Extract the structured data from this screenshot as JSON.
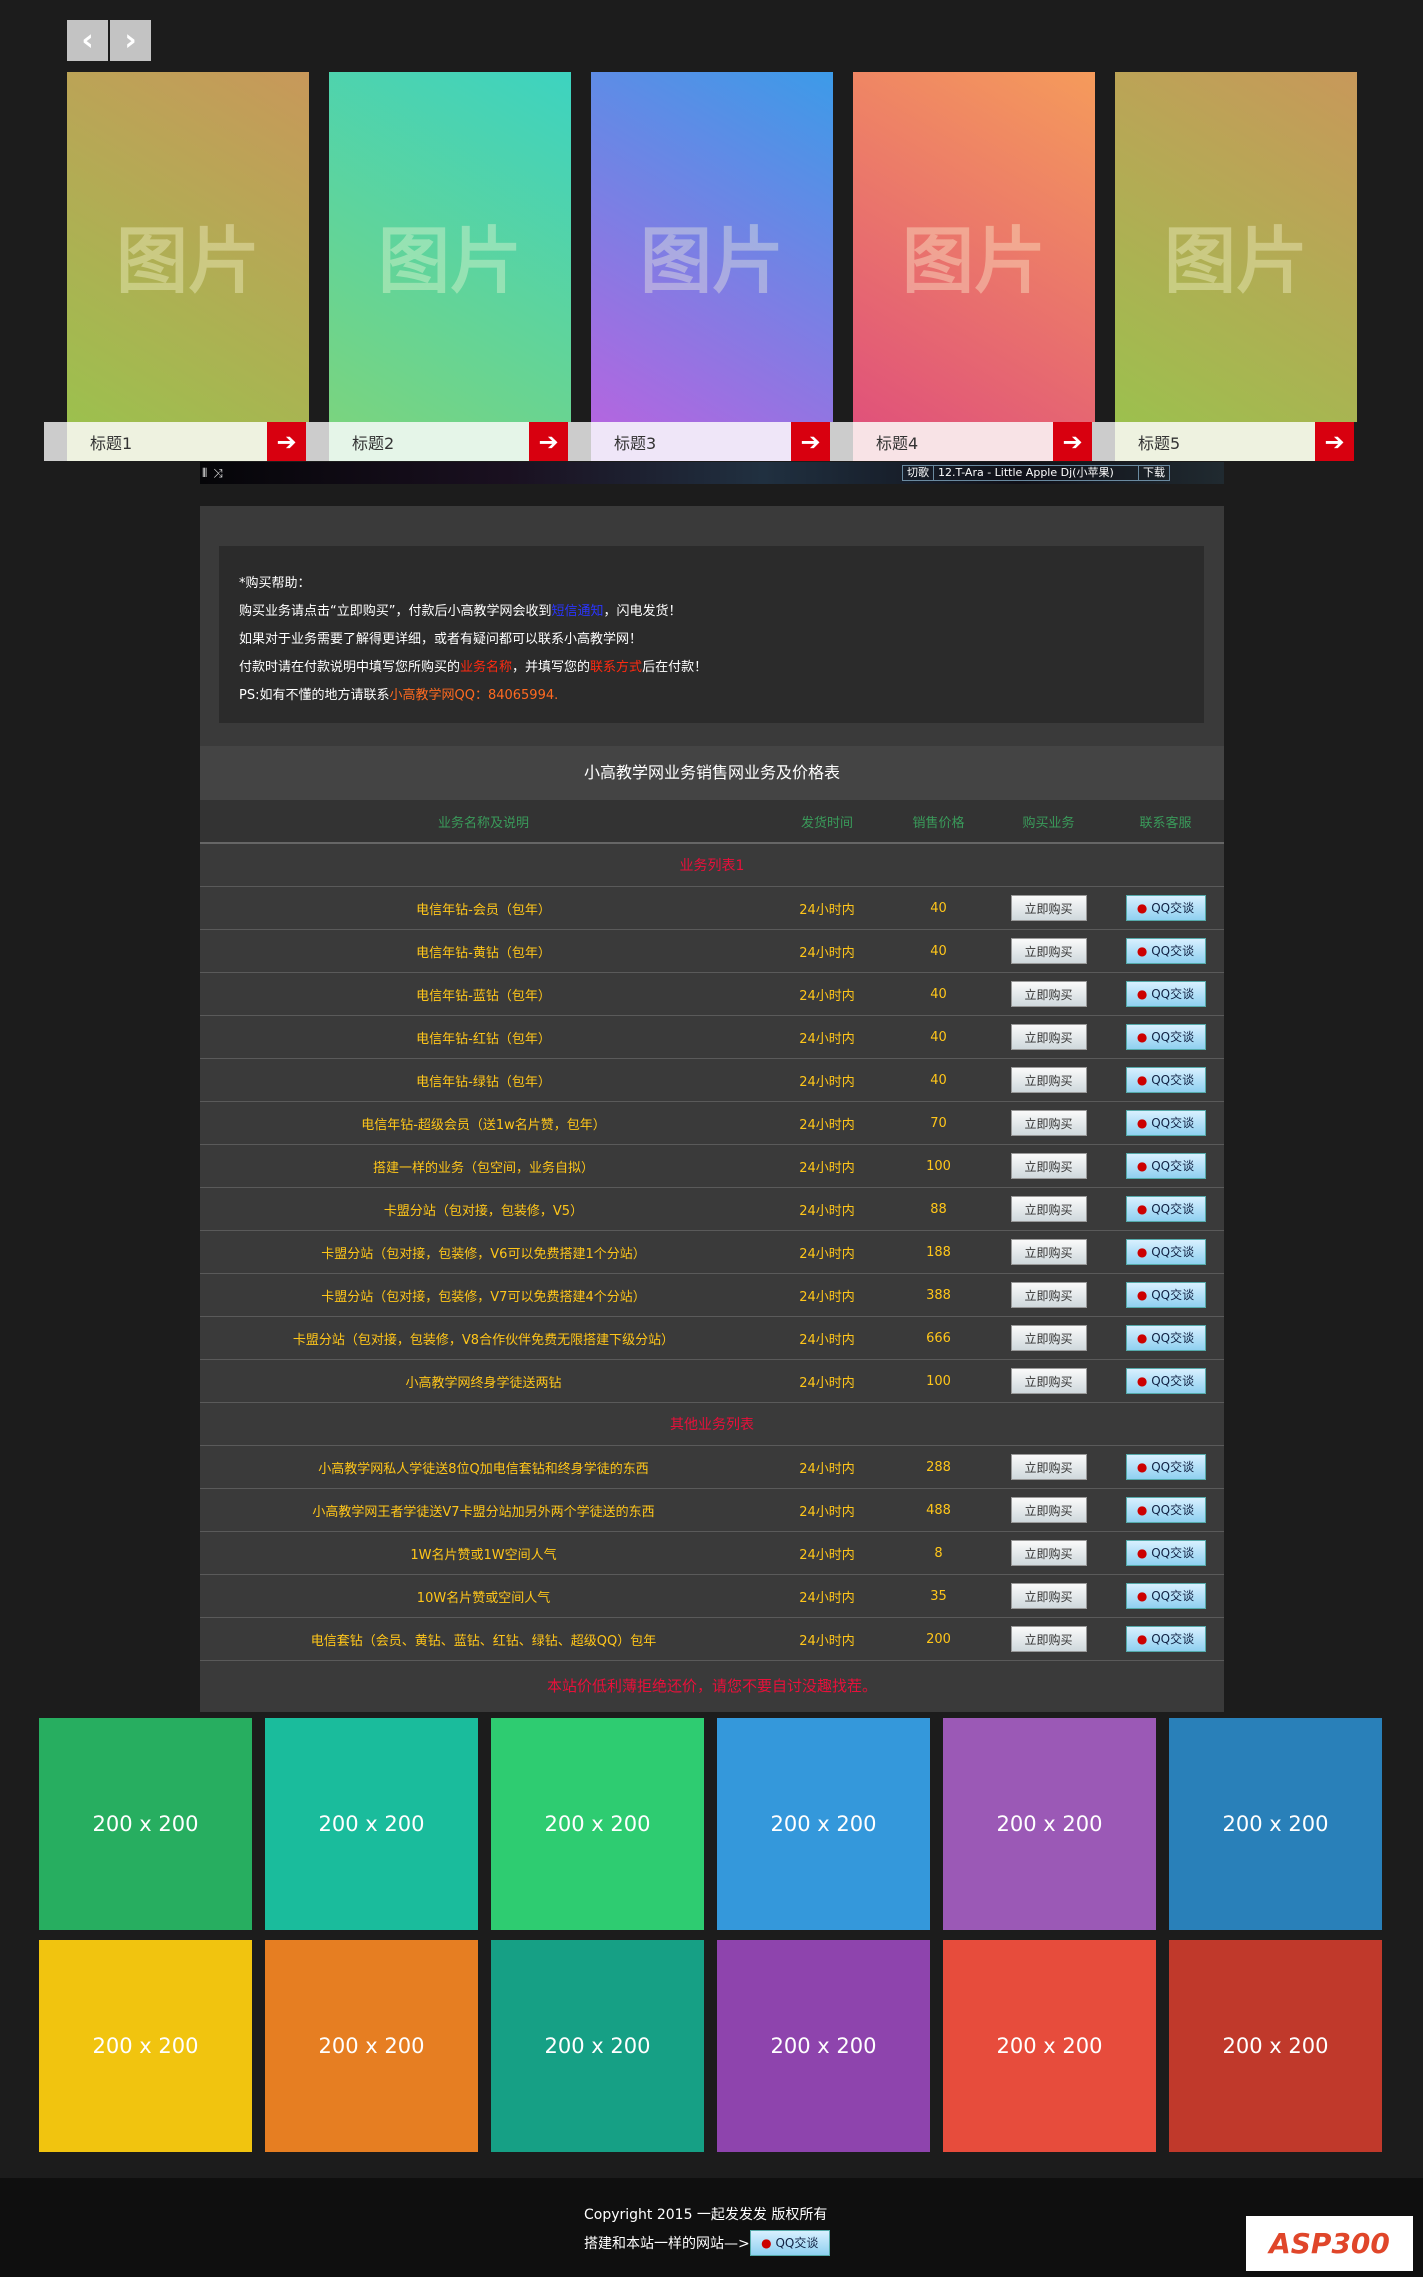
{
  "nav": {
    "prev": "‹",
    "next": "›"
  },
  "slides": [
    {
      "placeholder": "图片",
      "title": "标题1",
      "colors": [
        "#9cc04e",
        "#c8985a"
      ],
      "capbg": "#eef2e0"
    },
    {
      "placeholder": "图片",
      "title": "标题2",
      "colors": [
        "#7ad47f",
        "#3dd3c0"
      ],
      "capbg": "#e5f5e8"
    },
    {
      "placeholder": "图片",
      "title": "标题3",
      "colors": [
        "#b366e0",
        "#3c9be8"
      ],
      "capbg": "#efe6f8"
    },
    {
      "placeholder": "图片",
      "title": "标题4",
      "colors": [
        "#e0527a",
        "#f59b5b"
      ],
      "capbg": "#f8e3e6"
    },
    {
      "placeholder": "图片",
      "title": "标题5",
      "colors": [
        "#9cc04e",
        "#c8985a"
      ],
      "capbg": "#eef2e0"
    }
  ],
  "music": {
    "switch": "切歌",
    "song": "12.T-Ara - Little Apple Dj(小苹果)",
    "download": "下载"
  },
  "help": {
    "title": "*购买帮助：",
    "l1a": "购买业务请点击“立即购买”，付款后小高教学网会收到",
    "l1b": "短信通知",
    "l1c": "，闪电发货！",
    "l2": "如果对于业务需要了解得更详细，或者有疑问都可以联系小高教学网！",
    "l3a": "付款时请在付款说明中填写您所购买的",
    "l3b": "业务名称",
    "l3c": "，并填写您的",
    "l3d": "联系方式",
    "l3e": "后在付款！",
    "l4a": "PS:如有不懂的地方请联系",
    "l4b": "小高教学网QQ：84065994."
  },
  "table": {
    "title": "小高教学网业务销售网业务及价格表",
    "headers": [
      "业务名称及说明",
      "发货时间",
      "销售价格",
      "购买业务",
      "联系客服"
    ],
    "buy_label": "立即购买",
    "qq_label": "QQ交谈",
    "sections": [
      {
        "name": "业务列表1",
        "rows": [
          [
            "电信年钻-会员（包年）",
            "24小时内",
            "40"
          ],
          [
            "电信年钻-黄钻（包年）",
            "24小时内",
            "40"
          ],
          [
            "电信年钻-蓝钻（包年）",
            "24小时内",
            "40"
          ],
          [
            "电信年钻-红钻（包年）",
            "24小时内",
            "40"
          ],
          [
            "电信年钻-绿钻（包年）",
            "24小时内",
            "40"
          ],
          [
            "电信年钻-超级会员（送1w名片赞，包年）",
            "24小时内",
            "70"
          ],
          [
            "搭建一样的业务（包空间，业务自拟）",
            "24小时内",
            "100"
          ],
          [
            "卡盟分站（包对接，包装修，V5）",
            "24小时内",
            "88"
          ],
          [
            "卡盟分站（包对接，包装修，V6可以免费搭建1个分站）",
            "24小时内",
            "188"
          ],
          [
            "卡盟分站（包对接，包装修，V7可以免费搭建4个分站）",
            "24小时内",
            "388"
          ],
          [
            "卡盟分站（包对接，包装修，V8合作伙伴免费无限搭建下级分站）",
            "24小时内",
            "666"
          ],
          [
            "小高教学网终身学徒送两钻",
            "24小时内",
            "100"
          ]
        ]
      },
      {
        "name": "其他业务列表",
        "rows": [
          [
            "小高教学网私人学徒送8位Q加电信套钻和终身学徒的东西",
            "24小时内",
            "288"
          ],
          [
            "小高教学网王者学徒送V7卡盟分站加另外两个学徒送的东西",
            "24小时内",
            "488"
          ],
          [
            "1W名片赞或1W空间人气",
            "24小时内",
            "8"
          ],
          [
            "10W名片赞或空间人气",
            "24小时内",
            "35"
          ],
          [
            "电信套钻（会员、黄钻、蓝钻、红钻、绿钻、超级QQ）包年",
            "24小时内",
            "200"
          ]
        ]
      }
    ],
    "note": "本站价低利薄拒绝还价，请您不要自讨没趣找茬。"
  },
  "tiles": [
    {
      "label": "200 x 200",
      "color": "#27ae60"
    },
    {
      "label": "200 x 200",
      "color": "#1abc9c"
    },
    {
      "label": "200 x 200",
      "color": "#2ecc71"
    },
    {
      "label": "200 x 200",
      "color": "#3498db"
    },
    {
      "label": "200 x 200",
      "color": "#9b59b6"
    },
    {
      "label": "200 x 200",
      "color": "#2980b9"
    },
    {
      "label": "200 x 200",
      "color": "#f1c40f"
    },
    {
      "label": "200 x 200",
      "color": "#e67e22"
    },
    {
      "label": "200 x 200",
      "color": "#16a085"
    },
    {
      "label": "200 x 200",
      "color": "#8e44ad"
    },
    {
      "label": "200 x 200",
      "color": "#e74c3c"
    },
    {
      "label": "200 x 200",
      "color": "#c0392b"
    }
  ],
  "footer": {
    "copyright": "Copyright 2015 一起发发发 版权所有",
    "build": "搭建和本站一样的网站—>",
    "qq": "QQ交谈",
    "logo": "ASP300源码"
  }
}
